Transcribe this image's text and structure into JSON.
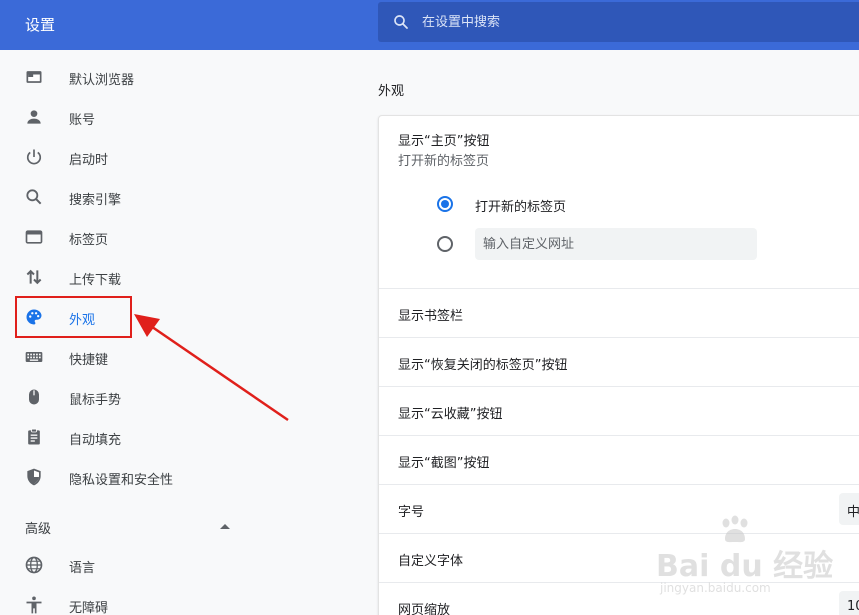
{
  "header": {
    "title": "设置",
    "search_placeholder": "在设置中搜索"
  },
  "sidebar": {
    "items": [
      {
        "label": "默认浏览器",
        "icon": "browser-window-icon"
      },
      {
        "label": "账号",
        "icon": "person-icon"
      },
      {
        "label": "启动时",
        "icon": "power-icon"
      },
      {
        "label": "搜索引擎",
        "icon": "search-icon"
      },
      {
        "label": "标签页",
        "icon": "tab-window-icon"
      },
      {
        "label": "上传下载",
        "icon": "upload-download-icon"
      },
      {
        "label": "外观",
        "icon": "palette-icon",
        "active": true
      },
      {
        "label": "快捷键",
        "icon": "keyboard-icon"
      },
      {
        "label": "鼠标手势",
        "icon": "mouse-icon"
      },
      {
        "label": "自动填充",
        "icon": "clipboard-icon"
      },
      {
        "label": "隐私设置和安全性",
        "icon": "shield-icon"
      }
    ],
    "advanced_label": "高级",
    "advanced_items": [
      {
        "label": "语言",
        "icon": "globe-icon"
      },
      {
        "label": "无障碍",
        "icon": "accessibility-icon"
      }
    ]
  },
  "main": {
    "section_title": "外观",
    "home_button": {
      "title": "显示“主页”按钮",
      "subtitle": "打开新的标签页",
      "options": [
        {
          "label": "打开新的标签页",
          "checked": true
        },
        {
          "label": "",
          "checked": false
        }
      ],
      "url_placeholder": "输入自定义网址"
    },
    "rows": [
      {
        "label": "显示书签栏"
      },
      {
        "label": "显示“恢复关闭的标签页”按钮"
      },
      {
        "label": "显示“云收藏”按钮"
      },
      {
        "label": "显示“截图”按钮"
      },
      {
        "label": "字号",
        "value": "中"
      },
      {
        "label": "自定义字体"
      },
      {
        "label": "网页缩放",
        "value": "10"
      }
    ]
  },
  "watermark": {
    "brand": "Bai du 经验",
    "url": "jingyan.baidu.com"
  },
  "colors": {
    "header": "#3b6ad8",
    "search": "#2f57b8",
    "accent": "#1a73e8",
    "annotation": "#e0201b"
  }
}
